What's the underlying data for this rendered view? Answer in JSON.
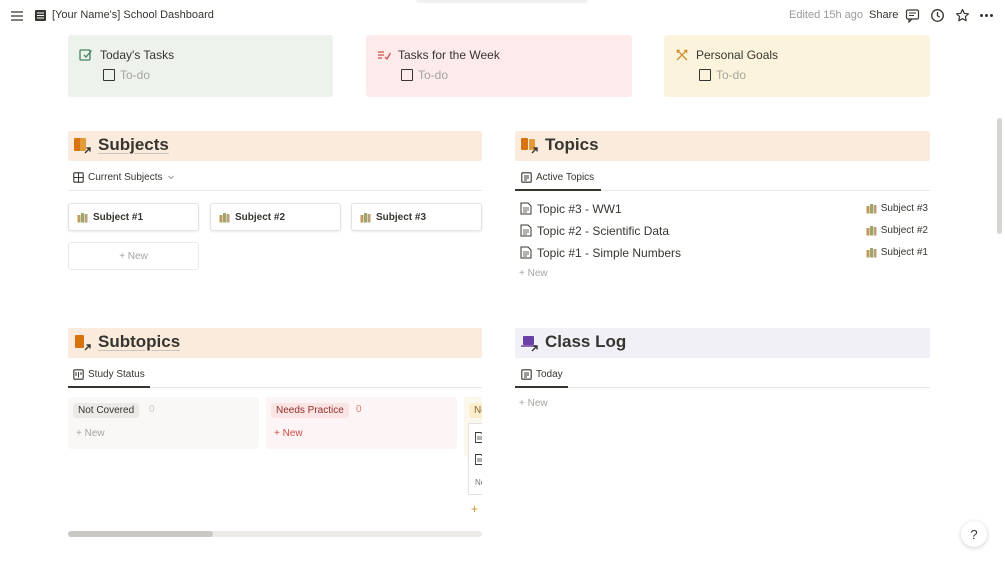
{
  "topbar": {
    "page_title": "[Your Name's] School Dashboard",
    "edited": "Edited 15h ago",
    "share": "Share",
    "icons": [
      "menu-icon",
      "comment-icon",
      "clock-icon",
      "star-icon",
      "more-icon"
    ]
  },
  "callouts": [
    {
      "title": "Today's Tasks",
      "todo": "To-do",
      "bg": "#edf3ec",
      "icon": "checkbox-pencil-icon",
      "icon_color": "#448361"
    },
    {
      "title": "Tasks for the Week",
      "todo": "To-do",
      "bg": "#fdebec",
      "icon": "list-check-icon",
      "icon_color": "#d44c47"
    },
    {
      "title": "Personal Goals",
      "todo": "To-do",
      "bg": "#fbf3db",
      "icon": "goal-icon",
      "icon_color": "#cb912f"
    }
  ],
  "subjects": {
    "title": "Subjects",
    "header_bg": "#faebdd",
    "view_label": "Current Subjects",
    "cards": [
      "Subject #1",
      "Subject #2",
      "Subject #3"
    ],
    "new_label": "+ New"
  },
  "topics": {
    "title": "Topics",
    "header_bg": "#faebdd",
    "view_label": "Active Topics",
    "rows": [
      {
        "name": "Topic #3 - WW1",
        "subject": "Subject #3"
      },
      {
        "name": "Topic #2 - Scientific Data",
        "subject": "Subject #2"
      },
      {
        "name": "Topic #1 - Simple Numbers",
        "subject": "Subject #1"
      }
    ],
    "new_label": "+ New"
  },
  "subtopics": {
    "title": "Subtopics",
    "header_bg": "#faebdd",
    "view_label": "Study Status",
    "columns": [
      {
        "label": "Not Covered",
        "count": "0",
        "new_label": "+ New",
        "bg": "#f9f8f7",
        "pill_bg": "#ebeae7",
        "pill_color": "#37352f"
      },
      {
        "label": "Needs Practice",
        "count": "0",
        "new_label": "+ New",
        "bg": "#fdf5f5",
        "pill_bg": "#fbe4e4",
        "pill_color": "#93302c"
      },
      {
        "label": "Ne",
        "new_label": "+",
        "bg": "#fbf7ec",
        "pill_bg": "#fbeecc",
        "pill_color": "#89632a",
        "card_text": "No"
      }
    ]
  },
  "class_log": {
    "title": "Class Log",
    "header_bg": "#f2f0f7",
    "view_label": "Today",
    "new_label": "+ New"
  },
  "help": "?"
}
